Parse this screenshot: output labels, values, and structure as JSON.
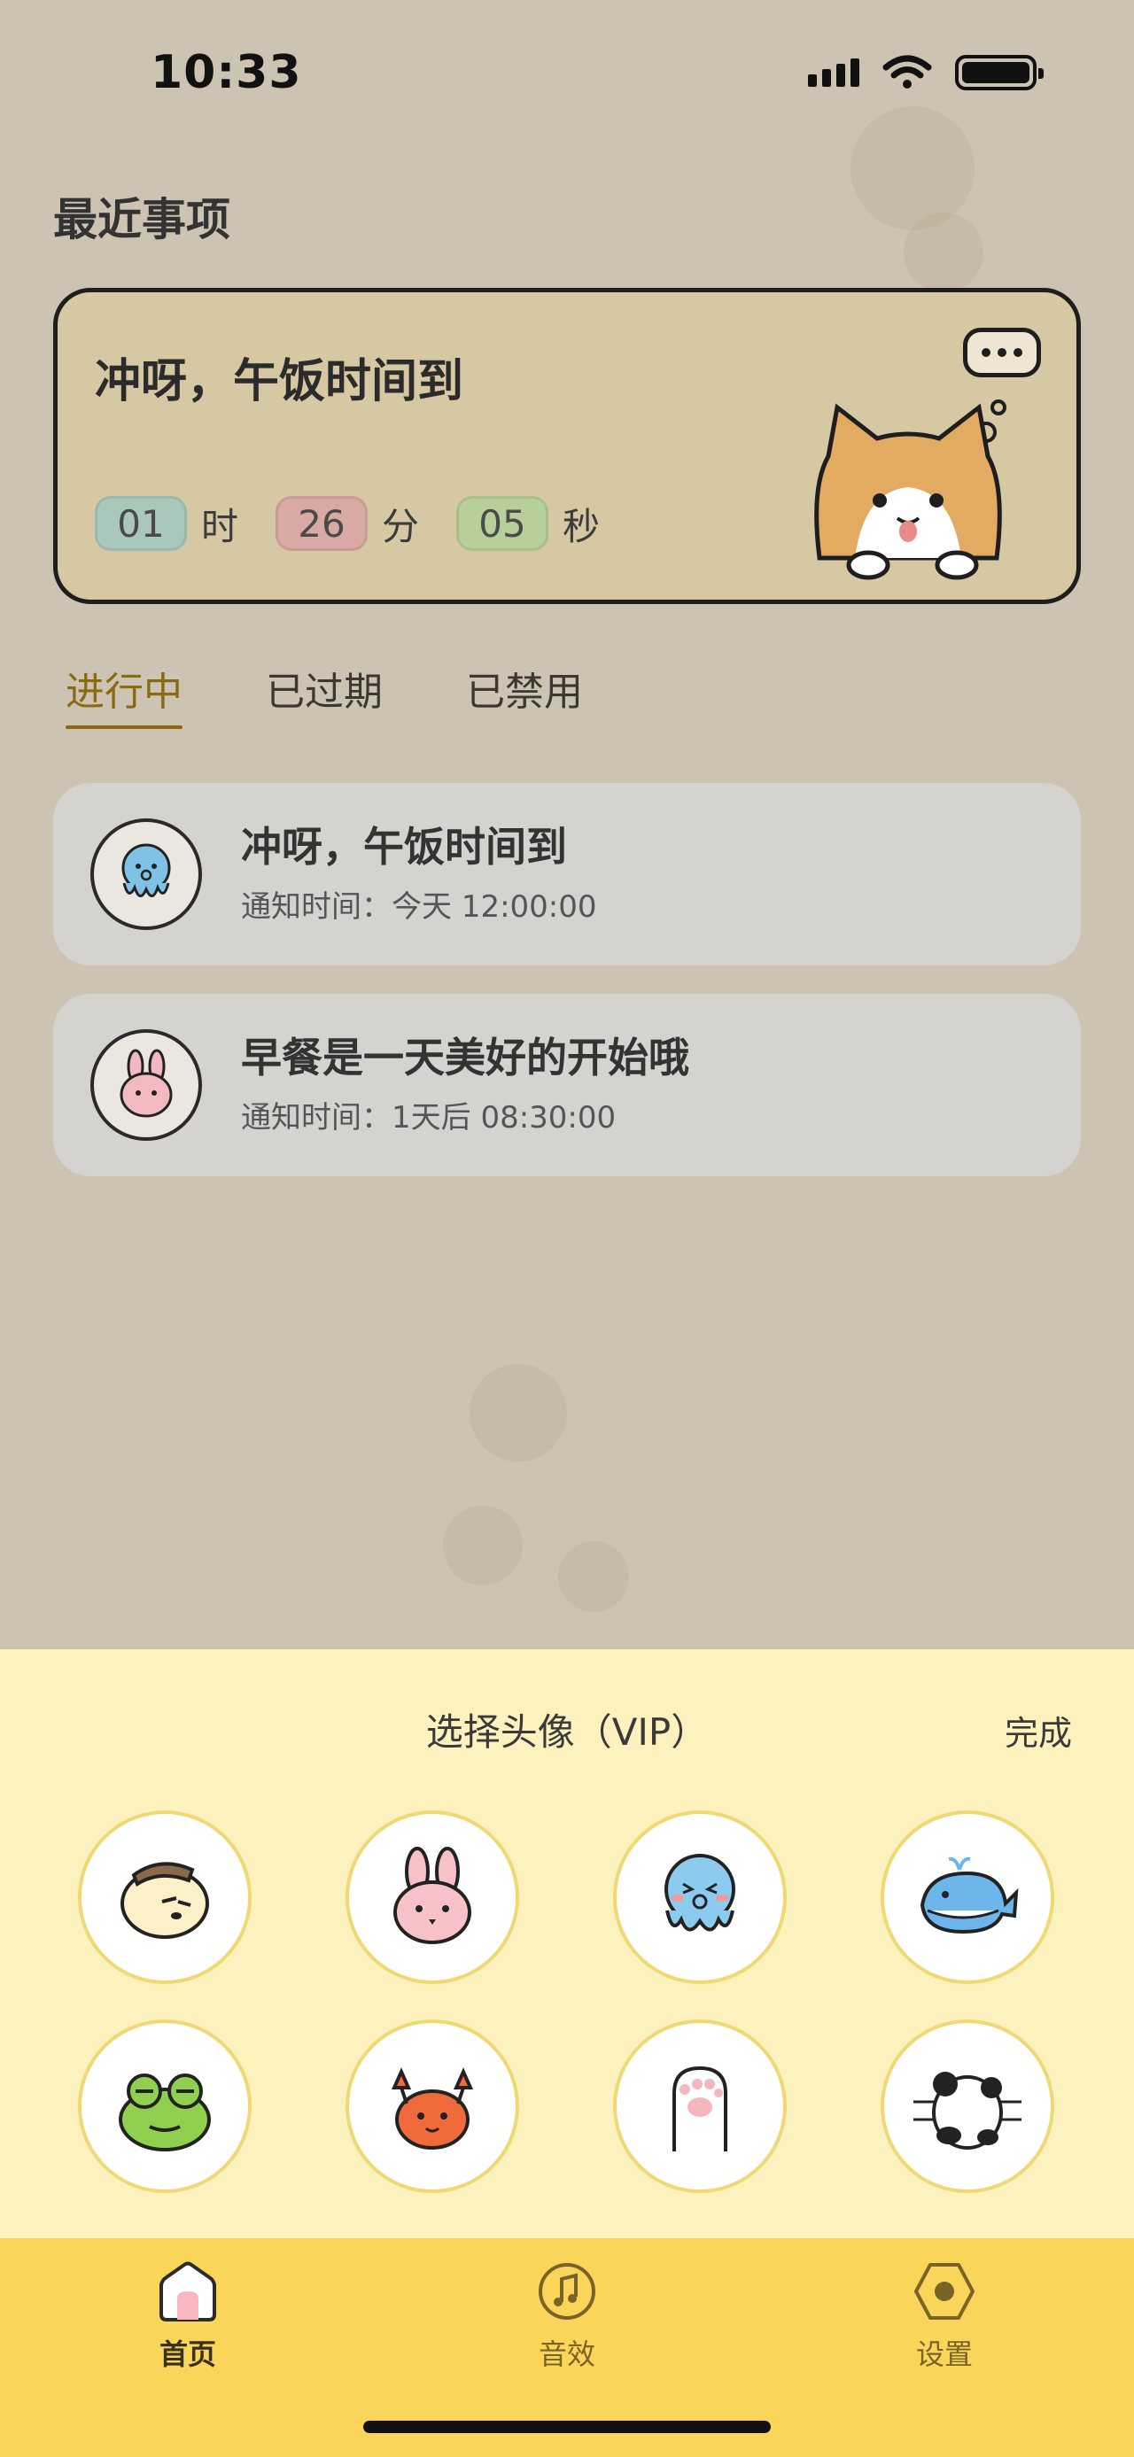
{
  "status_bar": {
    "time": "10:33"
  },
  "section_title": "最近事项",
  "featured": {
    "title": "冲呀，午饭时间到",
    "countdown": {
      "hours": "01",
      "hours_unit": "时",
      "minutes": "26",
      "minutes_unit": "分",
      "seconds": "05",
      "seconds_unit": "秒"
    }
  },
  "tabs": [
    {
      "label": "进行中",
      "active": true
    },
    {
      "label": "已过期",
      "active": false
    },
    {
      "label": "已禁用",
      "active": false
    }
  ],
  "reminders": [
    {
      "title": "冲呀，午饭时间到",
      "time": "通知时间：今天 12:00:00",
      "avatar": "octopus-icon"
    },
    {
      "title": "早餐是一天美好的开始哦",
      "time": "通知时间：1天后 08:30:00",
      "avatar": "bunny-icon"
    }
  ],
  "avatar_sheet": {
    "title": "选择头像（VIP）",
    "done_label": "完成",
    "avatars": [
      "bear-icon",
      "bunny-icon",
      "octopus-icon",
      "whale-icon",
      "frog-icon",
      "crab-icon",
      "cat-paw-icon",
      "panda-icon"
    ]
  },
  "tabbar": {
    "items": [
      {
        "label": "首页",
        "icon": "home-icon",
        "active": true
      },
      {
        "label": "音效",
        "icon": "music-icon",
        "active": false
      },
      {
        "label": "设置",
        "icon": "settings-icon",
        "active": false
      }
    ]
  },
  "colors": {
    "background": "#cdc3b2",
    "featured_card": "#d6c8a3",
    "accent": "#8a6a10",
    "sheet": "#fdf1bd",
    "tabbar": "#f9d55a"
  }
}
